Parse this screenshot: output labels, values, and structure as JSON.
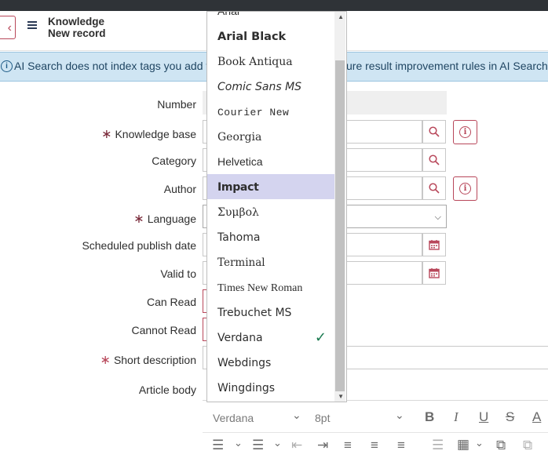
{
  "header": {
    "title": "Knowledge",
    "subtitle": "New record",
    "back_icon": "chevron-left-icon",
    "menu_icon": "hamburger-icon"
  },
  "banner": {
    "text_left": "AI Search does not index tags you add to",
    "text_right": "ure result improvement rules in AI Search"
  },
  "form": {
    "number_label": "Number",
    "knowledge_base_label": "Knowledge base",
    "category_label": "Category",
    "author_label": "Author",
    "language_label": "Language",
    "scheduled_publish_label": "Scheduled publish date",
    "valid_to_label": "Valid to",
    "can_read_label": "Can Read",
    "cannot_read_label": "Cannot Read",
    "short_description_label": "Short description",
    "article_body_label": "Article body",
    "required_marker": "∗"
  },
  "editor": {
    "font_family": "Verdana",
    "font_size": "8pt",
    "bold": "B",
    "italic": "I",
    "underline": "U",
    "strike": "S",
    "color": "A"
  },
  "font_dropdown": {
    "items": [
      {
        "label": "Arial",
        "font": "Liberation Sans"
      },
      {
        "label": "Arial Black",
        "font": "DejaVu Sans"
      },
      {
        "label": "Book Antiqua",
        "font": "DejaVu Serif"
      },
      {
        "label": "Comic Sans MS",
        "font": "DejaVu Sans"
      },
      {
        "label": "Courier New",
        "font": "Liberation Mono"
      },
      {
        "label": "Georgia",
        "font": "DejaVu Serif"
      },
      {
        "label": "Helvetica",
        "font": "Liberation Sans"
      },
      {
        "label": "Impact",
        "font": "DejaVu Sans"
      },
      {
        "label": "Συμβολ",
        "font": "DejaVu Serif"
      },
      {
        "label": "Tahoma",
        "font": "DejaVu Sans"
      },
      {
        "label": "Terminal",
        "font": "DejaVu Serif"
      },
      {
        "label": "Times New Roman",
        "font": "Liberation Serif"
      },
      {
        "label": "Trebuchet MS",
        "font": "DejaVu Sans"
      },
      {
        "label": "Verdana",
        "font": "DejaVu Sans"
      },
      {
        "label": "Webdings",
        "font": "DejaVu Sans"
      },
      {
        "label": "Wingdings",
        "font": "DejaVu Sans"
      }
    ],
    "highlighted": "Impact",
    "checked": "Verdana",
    "check_icon": "checkmark-icon"
  }
}
